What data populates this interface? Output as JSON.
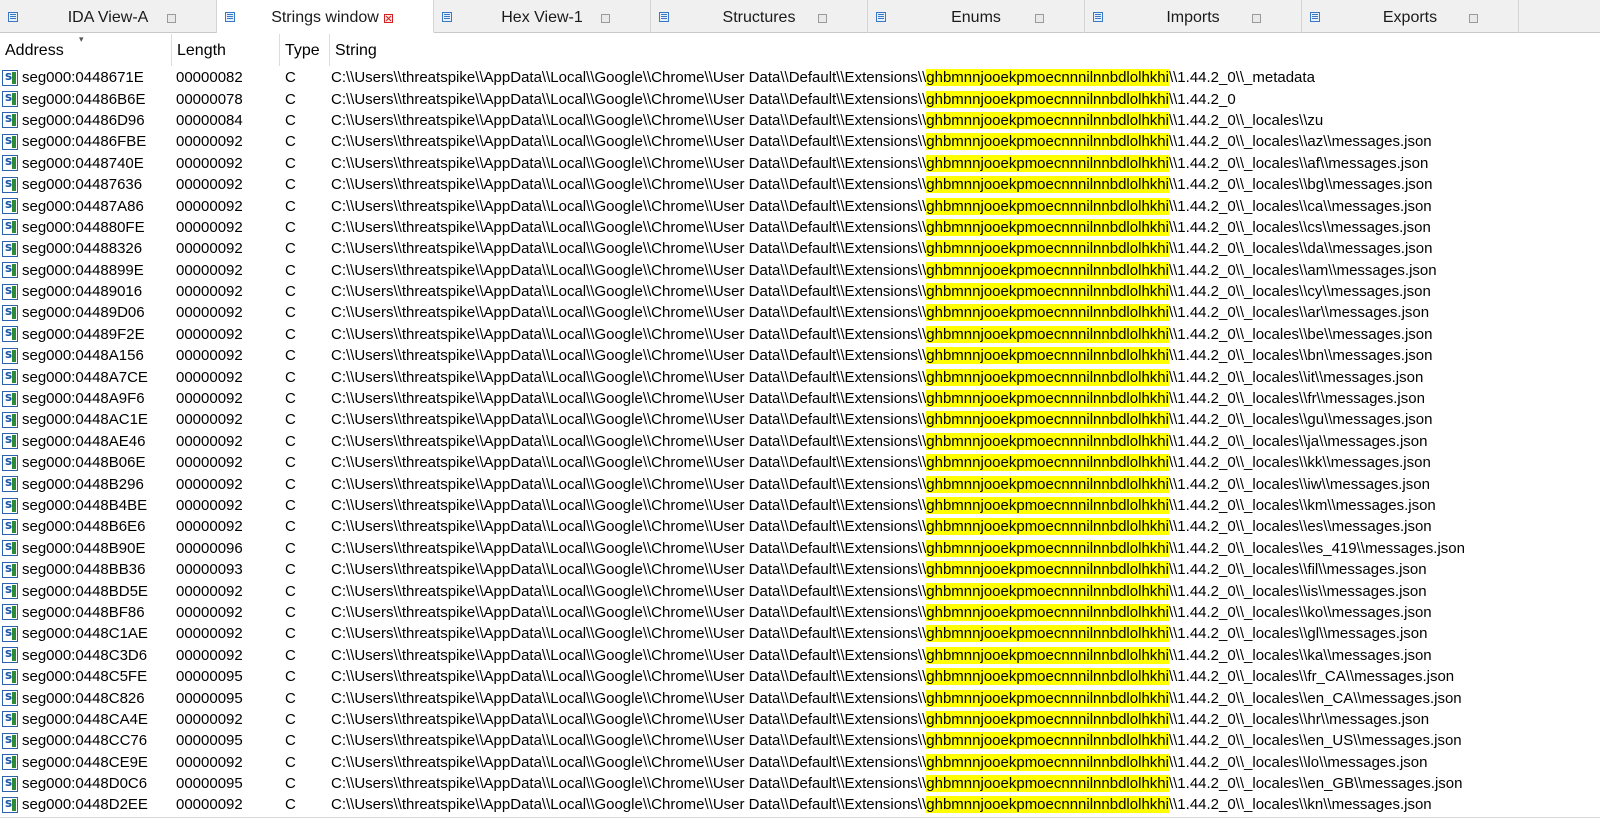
{
  "tabs": [
    {
      "label": "IDA View-A",
      "active": false
    },
    {
      "label": "Strings window",
      "active": true
    },
    {
      "label": "Hex View-1",
      "active": false
    },
    {
      "label": "Structures",
      "active": false
    },
    {
      "label": "Enums",
      "active": false
    },
    {
      "label": "Imports",
      "active": false
    },
    {
      "label": "Exports",
      "active": false
    }
  ],
  "columns": {
    "address": "Address",
    "length": "Length",
    "type": "Type",
    "string": "String"
  },
  "path_prefix": "C:\\\\Users\\\\threatspike\\\\AppData\\\\Local\\\\Google\\\\Chrome\\\\User Data\\\\Default\\\\Extensions\\\\",
  "highlight": "ghbmnnjooekpmoecnnnilnnbdlolhkhi",
  "rows": [
    {
      "address": "seg000:0448671E",
      "length": "00000082",
      "type": "C",
      "suffix": "\\\\1.44.2_0\\\\_metadata"
    },
    {
      "address": "seg000:04486B6E",
      "length": "00000078",
      "type": "C",
      "suffix": "\\\\1.44.2_0"
    },
    {
      "address": "seg000:04486D96",
      "length": "00000084",
      "type": "C",
      "suffix": "\\\\1.44.2_0\\\\_locales\\\\zu"
    },
    {
      "address": "seg000:04486FBE",
      "length": "00000092",
      "type": "C",
      "suffix": "\\\\1.44.2_0\\\\_locales\\\\az\\\\messages.json"
    },
    {
      "address": "seg000:0448740E",
      "length": "00000092",
      "type": "C",
      "suffix": "\\\\1.44.2_0\\\\_locales\\\\af\\\\messages.json"
    },
    {
      "address": "seg000:04487636",
      "length": "00000092",
      "type": "C",
      "suffix": "\\\\1.44.2_0\\\\_locales\\\\bg\\\\messages.json"
    },
    {
      "address": "seg000:04487A86",
      "length": "00000092",
      "type": "C",
      "suffix": "\\\\1.44.2_0\\\\_locales\\\\ca\\\\messages.json"
    },
    {
      "address": "seg000:044880FE",
      "length": "00000092",
      "type": "C",
      "suffix": "\\\\1.44.2_0\\\\_locales\\\\cs\\\\messages.json"
    },
    {
      "address": "seg000:04488326",
      "length": "00000092",
      "type": "C",
      "suffix": "\\\\1.44.2_0\\\\_locales\\\\da\\\\messages.json"
    },
    {
      "address": "seg000:0448899E",
      "length": "00000092",
      "type": "C",
      "suffix": "\\\\1.44.2_0\\\\_locales\\\\am\\\\messages.json"
    },
    {
      "address": "seg000:04489016",
      "length": "00000092",
      "type": "C",
      "suffix": "\\\\1.44.2_0\\\\_locales\\\\cy\\\\messages.json"
    },
    {
      "address": "seg000:04489D06",
      "length": "00000092",
      "type": "C",
      "suffix": "\\\\1.44.2_0\\\\_locales\\\\ar\\\\messages.json"
    },
    {
      "address": "seg000:04489F2E",
      "length": "00000092",
      "type": "C",
      "suffix": "\\\\1.44.2_0\\\\_locales\\\\be\\\\messages.json"
    },
    {
      "address": "seg000:0448A156",
      "length": "00000092",
      "type": "C",
      "suffix": "\\\\1.44.2_0\\\\_locales\\\\bn\\\\messages.json"
    },
    {
      "address": "seg000:0448A7CE",
      "length": "00000092",
      "type": "C",
      "suffix": "\\\\1.44.2_0\\\\_locales\\\\it\\\\messages.json"
    },
    {
      "address": "seg000:0448A9F6",
      "length": "00000092",
      "type": "C",
      "suffix": "\\\\1.44.2_0\\\\_locales\\\\fr\\\\messages.json"
    },
    {
      "address": "seg000:0448AC1E",
      "length": "00000092",
      "type": "C",
      "suffix": "\\\\1.44.2_0\\\\_locales\\\\gu\\\\messages.json"
    },
    {
      "address": "seg000:0448AE46",
      "length": "00000092",
      "type": "C",
      "suffix": "\\\\1.44.2_0\\\\_locales\\\\ja\\\\messages.json"
    },
    {
      "address": "seg000:0448B06E",
      "length": "00000092",
      "type": "C",
      "suffix": "\\\\1.44.2_0\\\\_locales\\\\kk\\\\messages.json"
    },
    {
      "address": "seg000:0448B296",
      "length": "00000092",
      "type": "C",
      "suffix": "\\\\1.44.2_0\\\\_locales\\\\iw\\\\messages.json"
    },
    {
      "address": "seg000:0448B4BE",
      "length": "00000092",
      "type": "C",
      "suffix": "\\\\1.44.2_0\\\\_locales\\\\km\\\\messages.json"
    },
    {
      "address": "seg000:0448B6E6",
      "length": "00000092",
      "type": "C",
      "suffix": "\\\\1.44.2_0\\\\_locales\\\\es\\\\messages.json"
    },
    {
      "address": "seg000:0448B90E",
      "length": "00000096",
      "type": "C",
      "suffix": "\\\\1.44.2_0\\\\_locales\\\\es_419\\\\messages.json"
    },
    {
      "address": "seg000:0448BB36",
      "length": "00000093",
      "type": "C",
      "suffix": "\\\\1.44.2_0\\\\_locales\\\\fil\\\\messages.json"
    },
    {
      "address": "seg000:0448BD5E",
      "length": "00000092",
      "type": "C",
      "suffix": "\\\\1.44.2_0\\\\_locales\\\\is\\\\messages.json"
    },
    {
      "address": "seg000:0448BF86",
      "length": "00000092",
      "type": "C",
      "suffix": "\\\\1.44.2_0\\\\_locales\\\\ko\\\\messages.json"
    },
    {
      "address": "seg000:0448C1AE",
      "length": "00000092",
      "type": "C",
      "suffix": "\\\\1.44.2_0\\\\_locales\\\\gl\\\\messages.json"
    },
    {
      "address": "seg000:0448C3D6",
      "length": "00000092",
      "type": "C",
      "suffix": "\\\\1.44.2_0\\\\_locales\\\\ka\\\\messages.json"
    },
    {
      "address": "seg000:0448C5FE",
      "length": "00000095",
      "type": "C",
      "suffix": "\\\\1.44.2_0\\\\_locales\\\\fr_CA\\\\messages.json"
    },
    {
      "address": "seg000:0448C826",
      "length": "00000095",
      "type": "C",
      "suffix": "\\\\1.44.2_0\\\\_locales\\\\en_CA\\\\messages.json"
    },
    {
      "address": "seg000:0448CA4E",
      "length": "00000092",
      "type": "C",
      "suffix": "\\\\1.44.2_0\\\\_locales\\\\hr\\\\messages.json"
    },
    {
      "address": "seg000:0448CC76",
      "length": "00000095",
      "type": "C",
      "suffix": "\\\\1.44.2_0\\\\_locales\\\\en_US\\\\messages.json"
    },
    {
      "address": "seg000:0448CE9E",
      "length": "00000092",
      "type": "C",
      "suffix": "\\\\1.44.2_0\\\\_locales\\\\lo\\\\messages.json"
    },
    {
      "address": "seg000:0448D0C6",
      "length": "00000095",
      "type": "C",
      "suffix": "\\\\1.44.2_0\\\\_locales\\\\en_GB\\\\messages.json"
    },
    {
      "address": "seg000:0448D2EE",
      "length": "00000092",
      "type": "C",
      "suffix": "\\\\1.44.2_0\\\\_locales\\\\kn\\\\messages.json"
    }
  ],
  "colors": {
    "highlight": "#ffff00",
    "tab_active_bg": "#ffffff",
    "tab_bar_bg": "#f0f0f0"
  },
  "icons": {
    "tab": "view-icon",
    "row": "string-icon",
    "close": "close-icon"
  }
}
